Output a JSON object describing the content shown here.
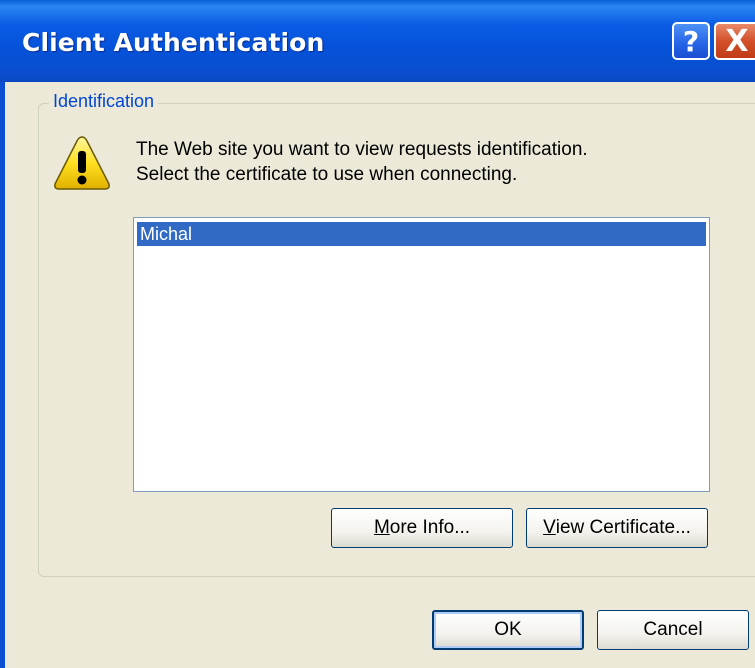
{
  "window": {
    "title": "Client Authentication",
    "help_glyph": "?",
    "close_glyph": "X"
  },
  "group": {
    "legend": "Identification"
  },
  "message": {
    "line1": "The Web site you want to view requests identification.",
    "line2": "Select the certificate to use when connecting."
  },
  "certificates": {
    "items": [
      "Michal"
    ],
    "selected": "Michal"
  },
  "buttons": {
    "more_info_accel": "M",
    "more_info_rest": "ore Info...",
    "view_cert_accel": "V",
    "view_cert_rest": "iew Certificate...",
    "ok": "OK",
    "cancel": "Cancel"
  },
  "colors": {
    "titlebar": "#0552d9",
    "selection": "#316ac5",
    "legend_text": "#0046d5",
    "dialog_bg": "#ece9d8"
  },
  "icons": {
    "warning": "warning-triangle-icon",
    "help": "help-icon",
    "close": "close-icon"
  }
}
